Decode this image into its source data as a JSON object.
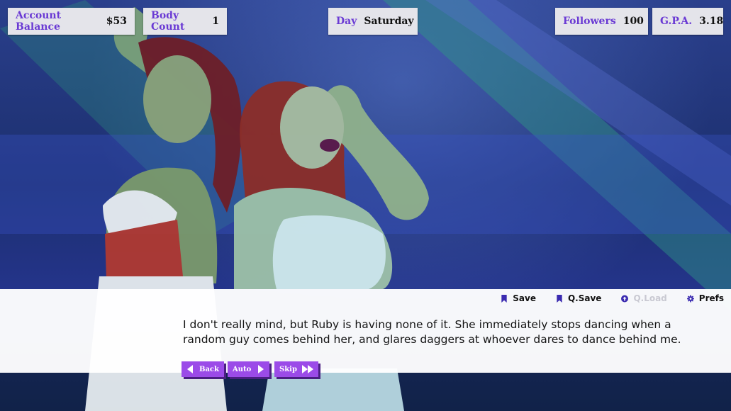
{
  "hud": {
    "account_balance": {
      "label": "Account Balance",
      "value": "$53"
    },
    "body_count": {
      "label": "Body Count",
      "value": "1"
    },
    "day": {
      "label": "Day",
      "value": "Saturday"
    },
    "followers": {
      "label": "Followers",
      "value": "100"
    },
    "gpa": {
      "label": "G.P.A.",
      "value": "3.18"
    }
  },
  "quick_menu": {
    "save": "Save",
    "qsave": "Q.Save",
    "qload": "Q.Load",
    "prefs": "Prefs"
  },
  "dialogue": {
    "text": "I don't really mind, but Ruby is having none of it. She immediately stops dancing when a random guy comes behind her, and glares daggers at whoever dares to dance behind me."
  },
  "controls": {
    "back": "Back",
    "auto": "Auto",
    "skip": "Skip"
  },
  "colors": {
    "accent": "#6a3ad4",
    "button": "#9b4be8",
    "hud_bg": "#e4e4ea"
  }
}
